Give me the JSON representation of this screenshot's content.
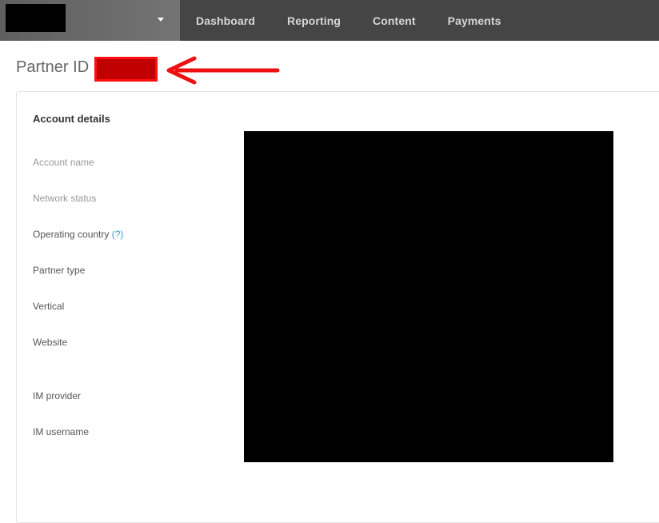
{
  "nav": {
    "items": [
      "Dashboard",
      "Reporting",
      "Content",
      "Payments"
    ]
  },
  "page": {
    "title": "Partner ID"
  },
  "account_details": {
    "title": "Account details",
    "fields": {
      "account_name": "Account name",
      "network_status": "Network status",
      "operating_country": "Operating country",
      "operating_country_help": "(?)",
      "partner_type": "Partner type",
      "vertical": "Vertical",
      "website": "Website",
      "im_provider": "IM provider",
      "im_username": "IM username"
    }
  },
  "colors": {
    "topbar": "#454545",
    "redaction": "#000000",
    "highlight": "#c00000",
    "arrow": "#ee1111",
    "help_link": "#2aa0c8"
  }
}
